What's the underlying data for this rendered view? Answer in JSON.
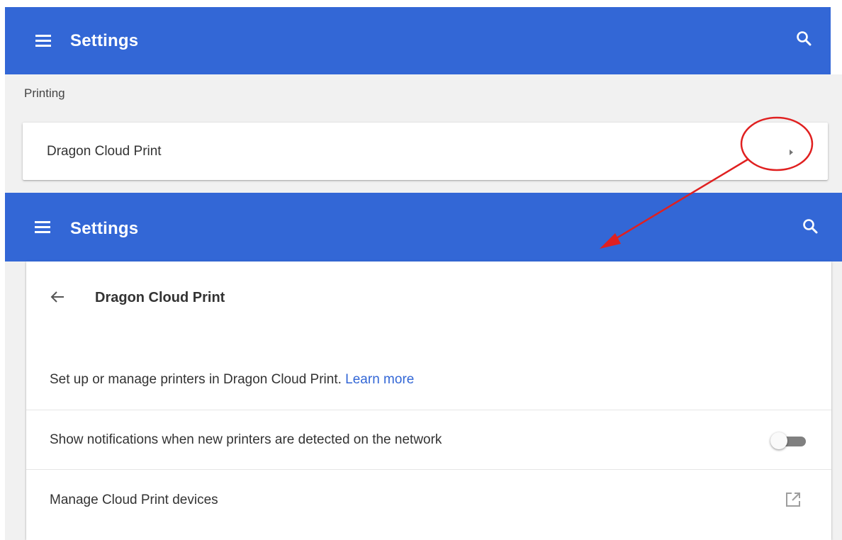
{
  "top_panel": {
    "toolbar": {
      "title": "Settings",
      "menu_icon": "hamburger-menu-icon",
      "search_icon": "search-icon"
    },
    "section_title": "Printing",
    "row": {
      "label": "Dragon Cloud Print",
      "icon": "arrow-right-icon"
    }
  },
  "annotation": {
    "color": "#e02020",
    "shapes": [
      "circle-highlight",
      "arrow"
    ]
  },
  "bottom_panel": {
    "toolbar": {
      "title": "Settings",
      "menu_icon": "hamburger-menu-icon",
      "search_icon": "search-icon"
    },
    "subpage": {
      "back_icon": "back-arrow-icon",
      "title": "Dragon Cloud Print",
      "description": "Set up or manage printers in Dragon Cloud Print.",
      "learn_more": "Learn more",
      "notifications_label": "Show notifications when new printers are detected on the network",
      "notifications_enabled": false,
      "manage_label": "Manage Cloud Print devices",
      "manage_icon": "open-in-new-icon"
    }
  },
  "colors": {
    "toolbar": "#3367d6",
    "link": "#3367d6",
    "background": "#f1f1f1"
  }
}
